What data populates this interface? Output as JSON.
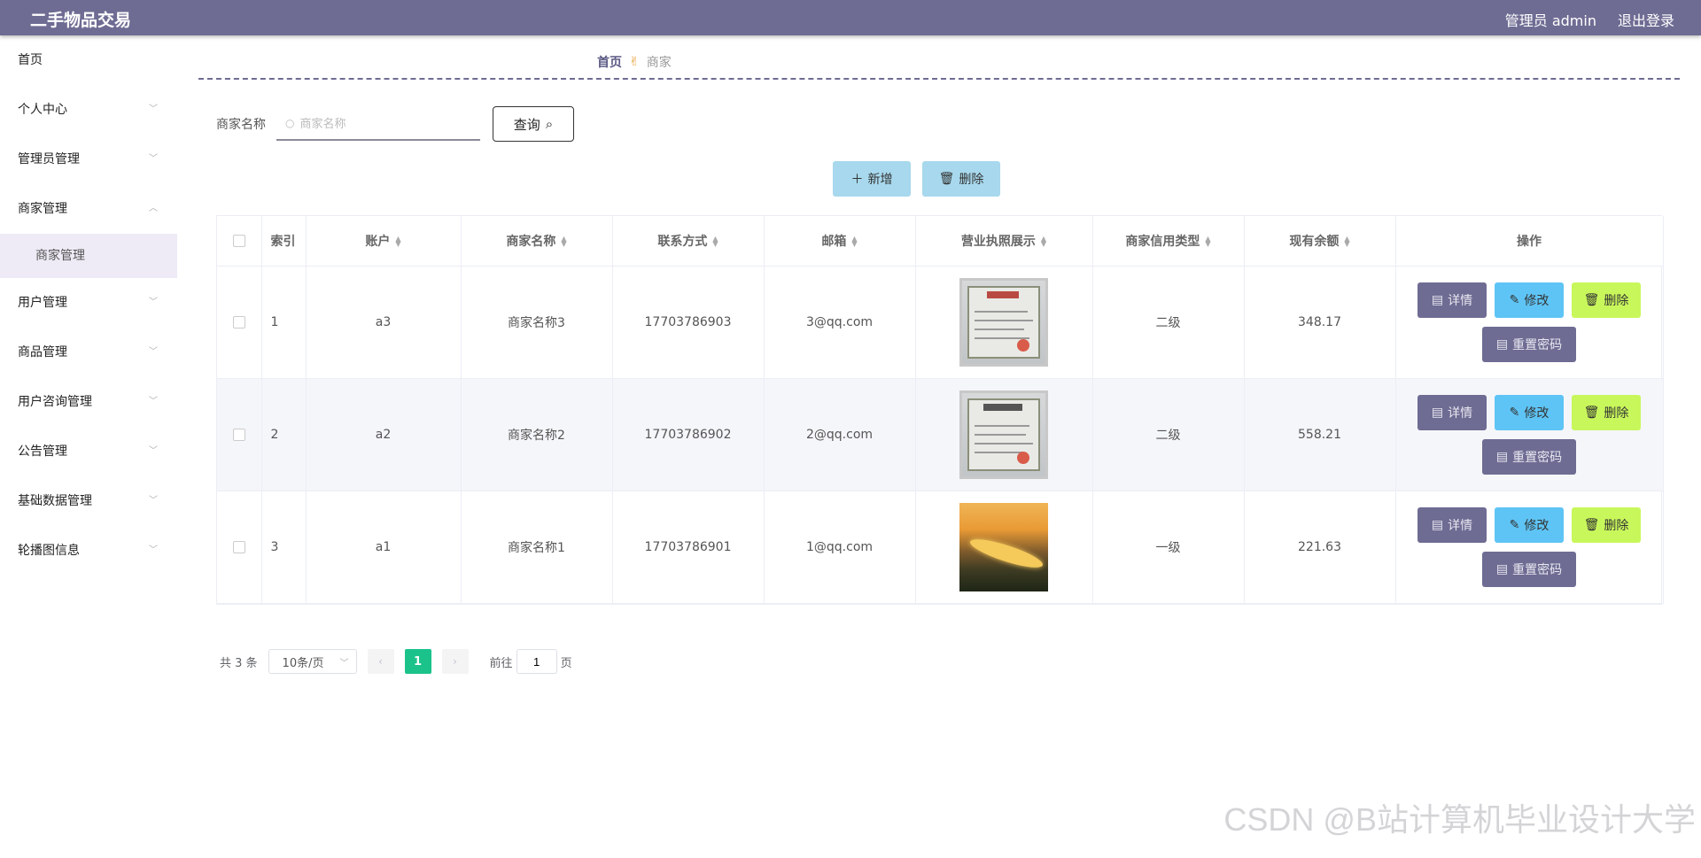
{
  "header": {
    "brand": "二手物品交易",
    "user_label": "管理员 admin",
    "logout_label": "退出登录"
  },
  "sidebar": {
    "items": [
      {
        "label": "首页",
        "chevron": ""
      },
      {
        "label": "个人中心",
        "chevron": "chevron-down-icon"
      },
      {
        "label": "管理员管理",
        "chevron": "chevron-down-icon"
      },
      {
        "label": "商家管理",
        "chevron": "chevron-up-icon"
      },
      {
        "label": "用户管理",
        "chevron": "chevron-down-icon"
      },
      {
        "label": "商品管理",
        "chevron": "chevron-down-icon"
      },
      {
        "label": "用户咨询管理",
        "chevron": "chevron-down-icon"
      },
      {
        "label": "公告管理",
        "chevron": "chevron-down-icon"
      },
      {
        "label": "基础数据管理",
        "chevron": "chevron-down-icon"
      },
      {
        "label": "轮播图信息",
        "chevron": "chevron-down-icon"
      }
    ],
    "active_sub": "商家管理"
  },
  "breadcrumb": {
    "home": "首页",
    "current": "商家"
  },
  "search": {
    "label": "商家名称",
    "placeholder": "商家名称",
    "value": "",
    "button_label": "查询"
  },
  "actions": {
    "add_label": "新增",
    "delete_label": "删除"
  },
  "table": {
    "headers": {
      "index": "索引",
      "account": "账户",
      "name": "商家名称",
      "phone": "联系方式",
      "email": "邮箱",
      "license": "营业执照展示",
      "credit": "商家信用类型",
      "balance": "现有余额",
      "ops": "操作"
    },
    "rows": [
      {
        "index": "1",
        "account": "a3",
        "name": "商家名称3",
        "phone": "17703786903",
        "email": "3@qq.com",
        "credit": "二级",
        "balance": "348.17"
      },
      {
        "index": "2",
        "account": "a2",
        "name": "商家名称2",
        "phone": "17703786902",
        "email": "2@qq.com",
        "credit": "二级",
        "balance": "558.21"
      },
      {
        "index": "3",
        "account": "a1",
        "name": "商家名称1",
        "phone": "17703786901",
        "email": "1@qq.com",
        "credit": "一级",
        "balance": "221.63"
      }
    ],
    "ops_labels": {
      "detail": "详情",
      "edit": "修改",
      "delete": "删除",
      "reset": "重置密码"
    }
  },
  "pagination": {
    "total_text": "共 3 条",
    "page_size": "10条/页",
    "current_page": "1",
    "goto_prefix": "前往",
    "goto_value": "1",
    "goto_suffix": "页"
  },
  "watermark": "CSDN @B站计算机毕业设计大学",
  "colors": {
    "header_bg": "#6e6c93",
    "accent_pager": "#1bc38b",
    "btn_light_blue": "#a7d8ed",
    "btn_edit": "#5ec4f5",
    "btn_delete": "#c8f75b"
  }
}
